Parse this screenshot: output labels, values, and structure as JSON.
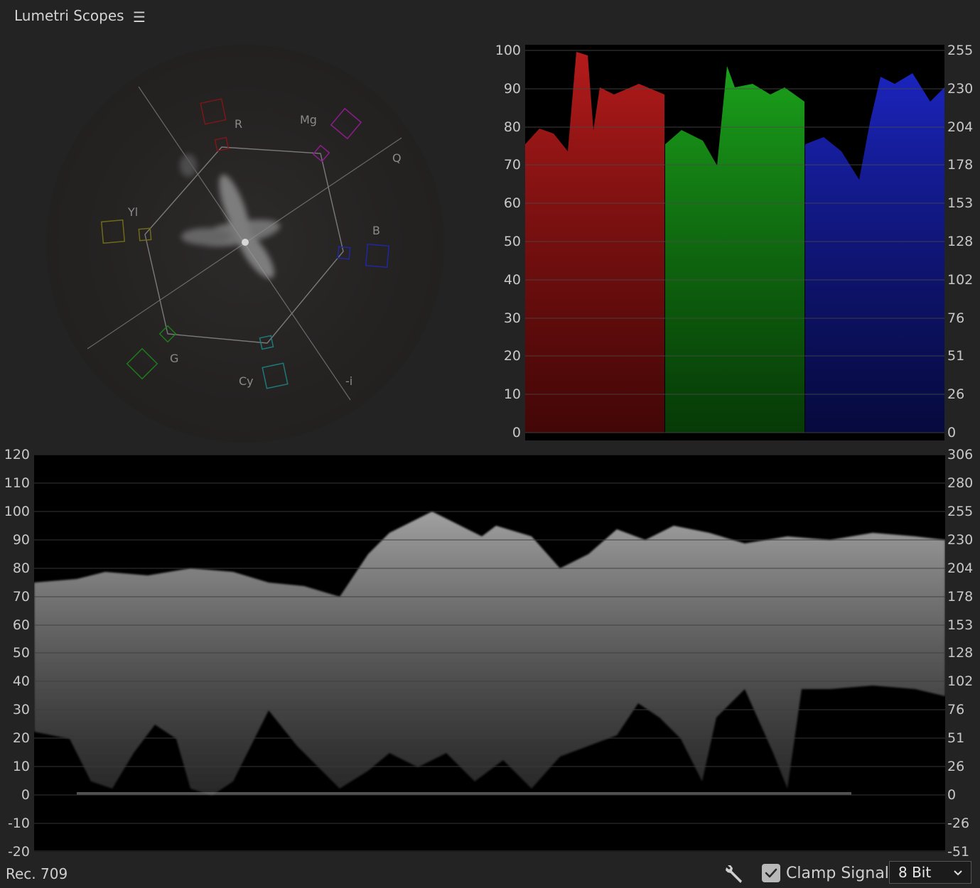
{
  "panel": {
    "title": "Lumetri Scopes",
    "menu_glyph": "☰"
  },
  "vectorscope": {
    "labels": {
      "r": "R",
      "mg": "Mg",
      "q": "Q",
      "yl": "Yl",
      "b": "B",
      "g": "G",
      "cy": "Cy",
      "neg_i": "-i"
    }
  },
  "parade": {
    "left_ticks": [
      "100",
      "90",
      "80",
      "70",
      "60",
      "50",
      "40",
      "30",
      "20",
      "10",
      "0"
    ],
    "right_ticks": [
      "255",
      "230",
      "204",
      "178",
      "153",
      "128",
      "102",
      "76",
      "51",
      "26",
      "0"
    ]
  },
  "waveform": {
    "left_ticks": [
      "120",
      "110",
      "100",
      "90",
      "80",
      "70",
      "60",
      "50",
      "40",
      "30",
      "20",
      "10",
      "0",
      "-10",
      "-20"
    ],
    "right_ticks": [
      "306",
      "280",
      "255",
      "230",
      "204",
      "178",
      "153",
      "128",
      "102",
      "76",
      "51",
      "26",
      "0",
      "-26",
      "-51"
    ]
  },
  "footer": {
    "colorspace": "Rec. 709",
    "clamp_label": "Clamp Signal",
    "clamp_checked": true,
    "bit_depth": "8 Bit"
  },
  "icons": {
    "menu": "hamburger-icon",
    "settings": "wrench-icon",
    "check": "checkmark-icon",
    "dropdown": "chevron-down-icon"
  },
  "colors": {
    "red": "#c81e1e",
    "green": "#1eb41e",
    "blue": "#1e28d2",
    "background": "#232323"
  }
}
